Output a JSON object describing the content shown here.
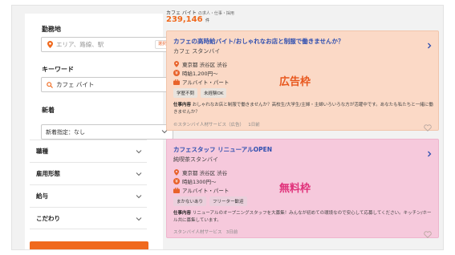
{
  "sidebar": {
    "location_label": "勤務地",
    "location_placeholder": "エリア、路線、駅",
    "select_button": "選択",
    "keyword_label": "キーワード",
    "keyword_value": "カフェ バイト",
    "new_label": "新着",
    "new_value": "新着指定：なし",
    "accordion": [
      "職種",
      "雇用形態",
      "給与",
      "こだわり"
    ]
  },
  "results": {
    "breadcrumb": "カフェ バイト",
    "breadcrumb_sub": "の求人・仕事・採用",
    "count": "239,146",
    "count_unit": "件"
  },
  "cards": [
    {
      "title": "カフェの高時給バイト/おしゃれなお店と制服で働きませんか？",
      "company": "カフェ スタンバイ",
      "location": "東京都 渋谷区 渋谷",
      "wage": "時給1,200円〜",
      "type": "アルバイト・パート",
      "tags": [
        "学歴不問",
        "未経験OK"
      ],
      "desc_label": "仕事内容",
      "desc": "おしゃれなお店と制服で働きませんか？高校生/大学生/主婦・主婦いろいろな方が活躍中です。あなたも私たちと一緒に働きませんか？",
      "source": "©スタンバイ人材サービス（広告）",
      "date": "1日前",
      "stamp": "広告枠",
      "colors": {
        "bg": "#fbd9c6",
        "stamp": "#e8571d"
      }
    },
    {
      "title": "カフェスタッフ リニューアルOPEN",
      "company": "純喫茶スタンバイ",
      "location": "東京都 渋谷区 渋谷",
      "wage": "時給1300円〜",
      "type": "アルバイト・パート",
      "tags": [
        "まかないあり",
        "フリーター歓迎"
      ],
      "desc_label": "仕事内容",
      "desc": "リニューアルのオープニングスタッフを大募集！みんなが初めての環境なので安心して応募してください。キッチン/ホール共に募集しています。",
      "source": "スタンバイ人材サービス",
      "date": "3日前",
      "stamp": "無料枠",
      "colors": {
        "bg": "#f6c9dc",
        "stamp": "#e0317a"
      }
    }
  ],
  "icons": [
    "map-pin-icon",
    "search-icon",
    "chevron-down-icon",
    "chevron-right-icon",
    "yen-icon",
    "briefcase-icon",
    "heart-icon"
  ],
  "accent": "#f0691d",
  "link": "#2f4fb0"
}
